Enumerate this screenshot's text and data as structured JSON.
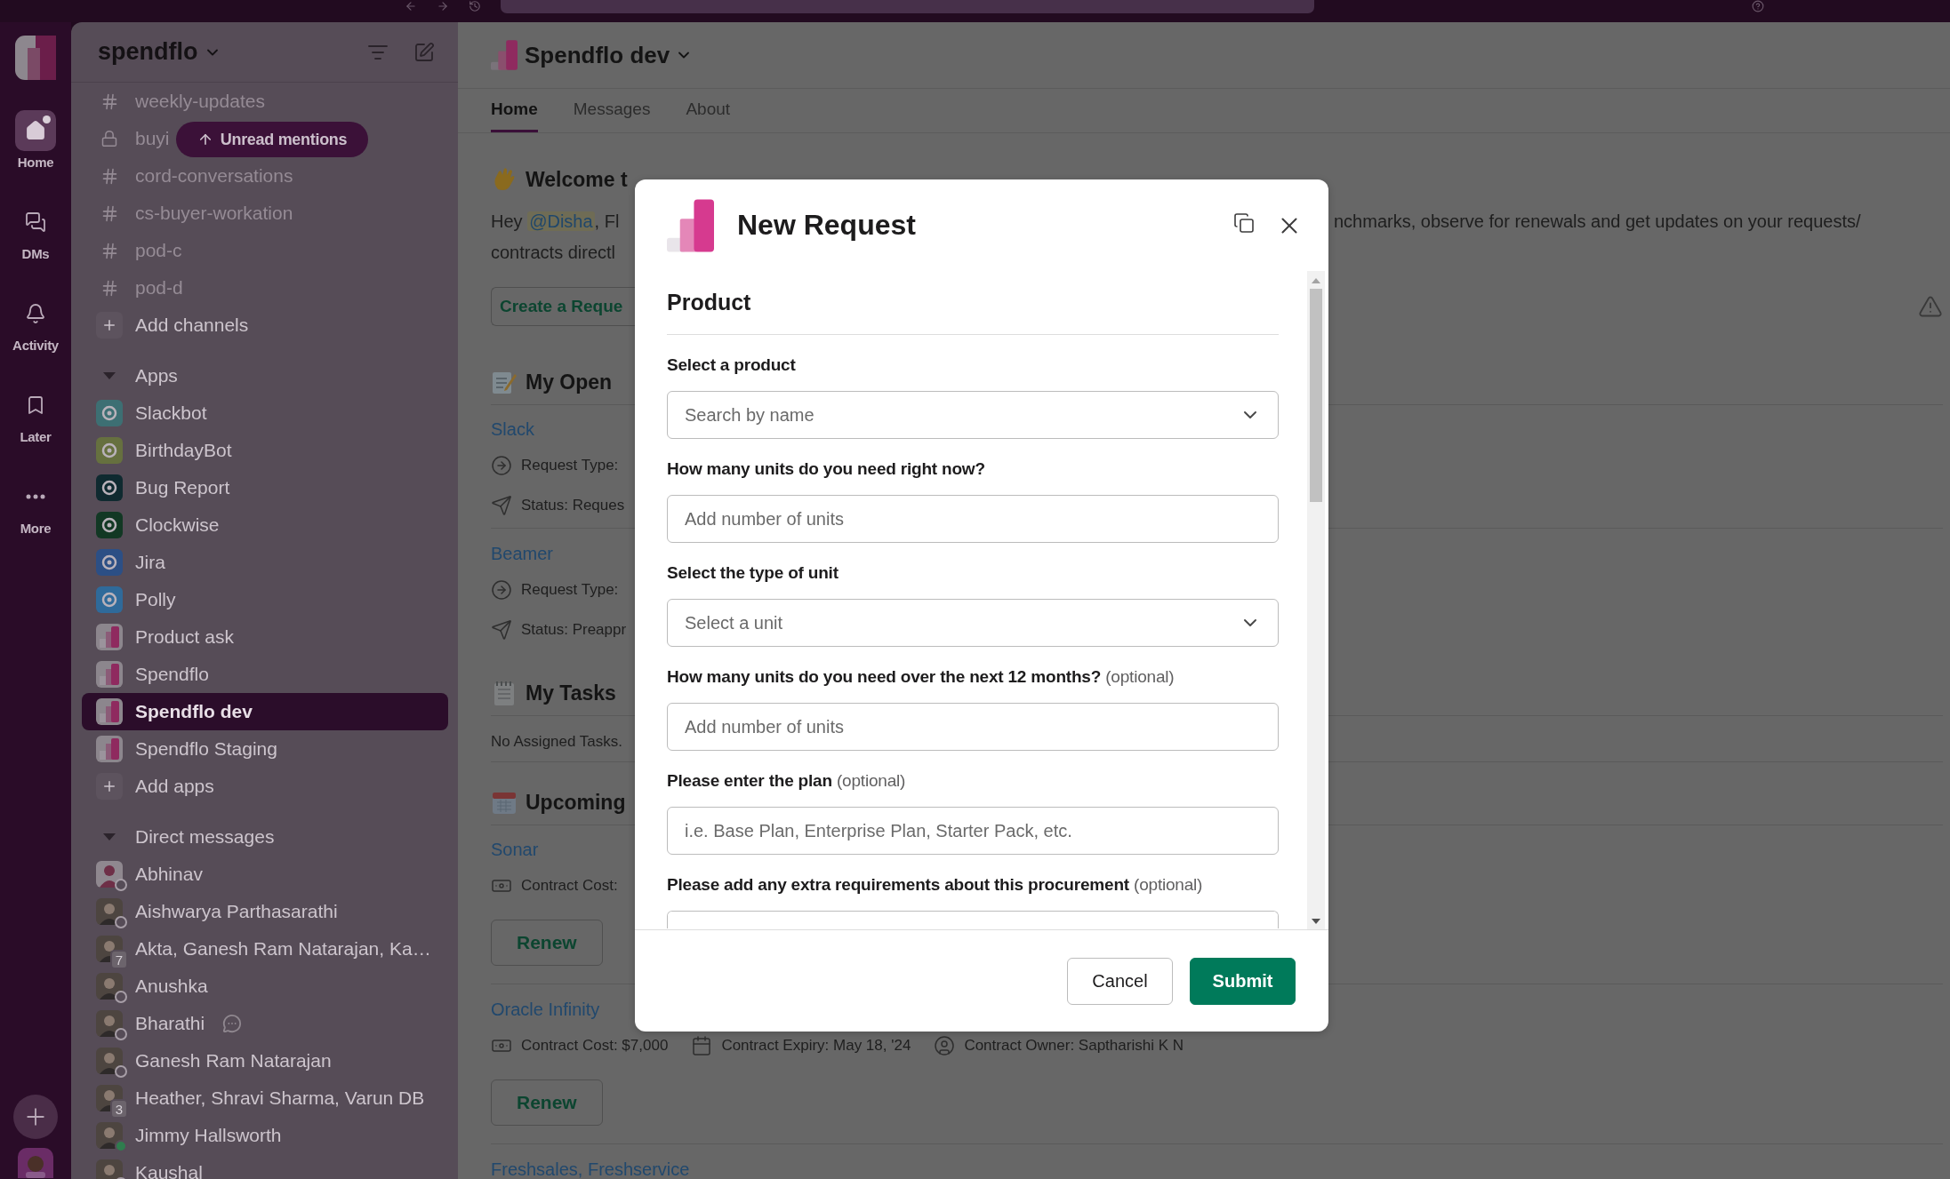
{
  "rail": {
    "items": [
      {
        "kind": "home",
        "label": "Home",
        "selected": true,
        "unread": true
      },
      {
        "kind": "dms",
        "label": "DMs",
        "selected": false,
        "unread": false
      },
      {
        "kind": "activity",
        "label": "Activity",
        "selected": false,
        "unread": false
      },
      {
        "kind": "later",
        "label": "Later",
        "selected": false,
        "unread": false
      },
      {
        "kind": "more",
        "label": "More",
        "selected": false,
        "unread": false
      }
    ]
  },
  "sidebar": {
    "workspace": "spendflo",
    "unread_pill": "Unread mentions",
    "channels": [
      {
        "kind": "public",
        "name": "weekly-updates",
        "muted": true
      },
      {
        "kind": "private",
        "name": "buyi",
        "muted": true
      },
      {
        "kind": "public",
        "name": "cord-conversations",
        "muted": true
      },
      {
        "kind": "public",
        "name": "cs-buyer-workation",
        "muted": true
      },
      {
        "kind": "public",
        "name": "pod-c",
        "muted": true
      },
      {
        "kind": "public",
        "name": "pod-d",
        "muted": true
      }
    ],
    "add_channels": "Add channels",
    "sections": [
      {
        "title": "Apps",
        "expanded": true,
        "add_label": "Add apps",
        "items": [
          {
            "kind": "app",
            "name": "Slackbot",
            "color": "#3d6f73",
            "selected": false
          },
          {
            "kind": "app",
            "name": "BirthdayBot",
            "color": "#66703f",
            "selected": false
          },
          {
            "kind": "app",
            "name": "Bug Report",
            "color": "#0f2a30",
            "selected": false
          },
          {
            "kind": "app",
            "name": "Clockwise",
            "color": "#123824",
            "selected": false
          },
          {
            "kind": "app",
            "name": "Jira",
            "color": "#2c4f85",
            "selected": false
          },
          {
            "kind": "app",
            "name": "Polly",
            "color": "#2f6a9a",
            "selected": false
          },
          {
            "kind": "spendflo",
            "name": "Product ask",
            "selected": false
          },
          {
            "kind": "spendflo",
            "name": "Spendflo",
            "selected": false
          },
          {
            "kind": "spendflo",
            "name": "Spendflo dev",
            "selected": true
          },
          {
            "kind": "spendflo",
            "name": "Spendflo Staging",
            "selected": false
          }
        ]
      },
      {
        "title": "Direct messages",
        "expanded": true,
        "items": [
          {
            "kind": "person",
            "photo": false,
            "name": "Abhinav",
            "active": false,
            "status_icon": false,
            "selected": false
          },
          {
            "kind": "person",
            "photo": true,
            "name": "Aishwarya Parthasarathi",
            "active": false,
            "status_icon": false,
            "selected": false
          },
          {
            "kind": "group",
            "photo": true,
            "name": "Akta, Ganesh Ram Natarajan, Ka…",
            "count": "7",
            "status_icon": false,
            "selected": false
          },
          {
            "kind": "person",
            "photo": true,
            "name": "Anushka",
            "active": false,
            "status_icon": false,
            "selected": false
          },
          {
            "kind": "person",
            "photo": true,
            "name": "Bharathi",
            "active": false,
            "status_icon": true,
            "selected": false
          },
          {
            "kind": "person",
            "photo": true,
            "name": "Ganesh Ram Natarajan",
            "active": false,
            "status_icon": false,
            "selected": false
          },
          {
            "kind": "group",
            "photo": true,
            "name": "Heather, Shravi Sharma, Varun DB",
            "count": "3",
            "status_icon": false,
            "selected": false
          },
          {
            "kind": "person",
            "photo": true,
            "name": "Jimmy Hallsworth",
            "active": true,
            "status_icon": false,
            "selected": false
          },
          {
            "kind": "person",
            "photo": true,
            "name": "Kaushal",
            "active": false,
            "status_icon": false,
            "selected": false
          }
        ]
      }
    ]
  },
  "main": {
    "title": "Spendflo dev",
    "tabs": [
      {
        "label": "Home",
        "selected": true
      },
      {
        "label": "Messages",
        "selected": false
      },
      {
        "label": "About",
        "selected": false
      }
    ],
    "welcome": {
      "heading": "Welcome t",
      "greeting": "Hey",
      "mention": "@Disha",
      "greeting_tail": ", Fl",
      "line_right": "nchmarks, observe for renewals and get updates on your requests/",
      "line_2": "contracts directl",
      "button": "Create a Reque"
    },
    "sections": [
      {
        "kind": "memo",
        "heading": "My Open",
        "items": [
          {
            "name": "Slack",
            "details": [
              {
                "kind": "type",
                "text": "Request Type:"
              },
              {
                "kind": "status",
                "text": "Status: Reques"
              }
            ]
          },
          {
            "name": "Beamer",
            "details": [
              {
                "kind": "type",
                "text": "Request Type:"
              },
              {
                "kind": "status",
                "text": "Status: Preappr"
              }
            ]
          }
        ]
      },
      {
        "kind": "notepad",
        "heading": "My Tasks",
        "empty": "No Assigned Tasks."
      },
      {
        "kind": "calendar",
        "heading": "Upcoming",
        "items": [
          {
            "name": "Sonar",
            "details": [
              {
                "kind": "cost",
                "text": "Contract Cost:"
              }
            ],
            "button": "Renew"
          },
          {
            "name": "Oracle Infinity",
            "details": [
              {
                "kind": "cost",
                "text": "Contract Cost: $7,000"
              },
              {
                "kind": "expiry",
                "text": "Contract Expiry: May 18, '24"
              },
              {
                "kind": "owner",
                "text": "Contract Owner: Saptharishi K N"
              }
            ],
            "button": "Renew"
          },
          {
            "name": "Freshsales, Freshservice"
          }
        ]
      }
    ]
  },
  "modal": {
    "title": "New Request",
    "section": "Product",
    "fields": [
      {
        "kind": "select",
        "label": "Select a product",
        "placeholder": "Search by name"
      },
      {
        "kind": "input",
        "label": "How many units do you need right now?",
        "placeholder": "Add number of units"
      },
      {
        "kind": "select",
        "label": "Select the type of unit",
        "placeholder": "Select a unit"
      },
      {
        "kind": "input",
        "label": "How many units do you need over the next 12 months?",
        "hint": "(optional)",
        "placeholder": "Add number of units"
      },
      {
        "kind": "input",
        "label": "Please enter the plan",
        "hint": "(optional)",
        "placeholder": "i.e. Base Plan, Enterprise Plan, Starter Pack, etc."
      },
      {
        "kind": "textarea",
        "label": "Please add any extra requirements about this procurement",
        "hint": "(optional)"
      }
    ],
    "buttons": [
      {
        "kind": "secondary",
        "label": "Cancel"
      },
      {
        "kind": "primary",
        "label": "Submit"
      }
    ]
  }
}
